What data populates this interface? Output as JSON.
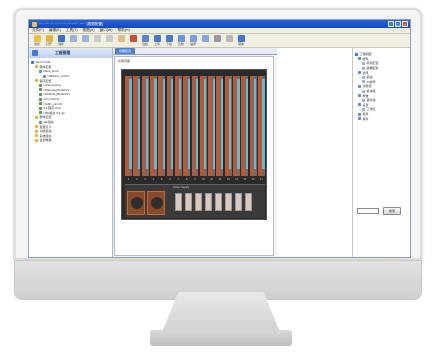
{
  "window": {
    "title": "···· ···· ··· ····· ··· ·········· ····· [视图配置]",
    "buttons": {
      "minimize": "_",
      "maximize": "□",
      "close": "×"
    }
  },
  "menu": [
    "文件(F)",
    "编辑(E)",
    "工具(T)",
    "视图(V)",
    "窗口(W)",
    "帮助(H)"
  ],
  "toolbar": [
    {
      "label": "新建",
      "icon": "new-icon"
    },
    {
      "label": "打开",
      "icon": "open-folder-icon"
    },
    {
      "label": "保存",
      "icon": "save-icon"
    },
    {
      "label": "",
      "icon": "undo-icon"
    },
    {
      "label": "",
      "icon": "redo-icon"
    },
    {
      "label": "",
      "icon": "cut-icon"
    },
    {
      "label": "",
      "icon": "copy-icon"
    },
    {
      "label": "",
      "icon": "paste-icon"
    },
    {
      "label": "",
      "icon": "delete-icon"
    },
    {
      "label": "连接",
      "icon": "connect-icon"
    },
    {
      "label": "上传",
      "icon": "upload-icon"
    },
    {
      "label": "下载",
      "icon": "download-icon"
    },
    {
      "label": "比较",
      "icon": "compare-icon"
    },
    {
      "label": "编译",
      "icon": "compile-icon"
    },
    {
      "label": "",
      "icon": "monitor-icon"
    },
    {
      "label": "",
      "icon": "settings-icon"
    },
    {
      "label": "",
      "icon": "help-icon"
    },
    {
      "label": "帮助",
      "icon": "info-icon"
    }
  ],
  "left_panel": {
    "title": "工程管理",
    "tree": [
      "Ws:Ir-Ir2v8",
      "硬件配置",
      "Rack_Drub",
      "UI9Rack_Grub2",
      "程序配置",
      "U4Sruckprog",
      "UiSKe4pg5G4ktGV",
      "UuR6c4pg5G4ktGV",
      "CFC:GFCG",
      "UGRL_pk:GS",
      "ST 程序 CFC",
      "LBD组态 U4_gk",
      "硬件配置",
      "DK组态",
      "变量定义",
      "功能模块",
      "系统组态",
      "监视数据"
    ]
  },
  "tab": {
    "label": "视图配置"
  },
  "document": {
    "label": "机架视图",
    "slot_numbers": [
      "1",
      "2",
      "3",
      "4",
      "5",
      "6",
      "7",
      "8",
      "9",
      "10",
      "11",
      "12",
      "13",
      "14",
      "15",
      "16",
      "17"
    ],
    "chassis_label": "Power Supply"
  },
  "right_tree": {
    "items": [
      "工程视图",
      "硬件",
      "机架配置",
      "插槽配置",
      "通讯",
      "模块",
      "IO信号",
      "诊断组",
      "模块组",
      "参数",
      "事件组",
      "设置",
      "工作区",
      "插件",
      "事件"
    ]
  },
  "search": {
    "placeholder": "",
    "button_label": "搜索"
  },
  "colors": {
    "titlebar": "#1551c9",
    "card_orange": "#c0562f",
    "card_cyan": "#5bbfd9",
    "tab_blue": "#4d7fd2"
  }
}
